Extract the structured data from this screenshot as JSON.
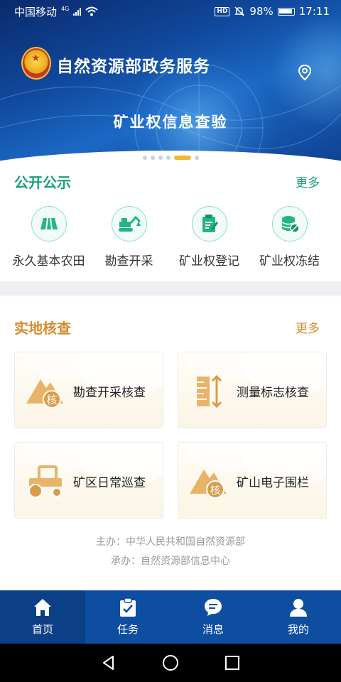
{
  "status_bar": {
    "carrier": "中国移动",
    "network": "4G",
    "battery": "98%",
    "time": "17:11",
    "hd": "HD"
  },
  "banner": {
    "title": "自然资源部政务服务",
    "subtitle": "矿业权信息查验",
    "carousel_total": 6,
    "carousel_active": 5
  },
  "public": {
    "title": "公开公示",
    "more": "更多",
    "items": [
      {
        "label": "永久基本农田",
        "icon": "farmland-icon"
      },
      {
        "label": "勘查开采",
        "icon": "excavator-icon"
      },
      {
        "label": "矿业权登记",
        "icon": "register-icon"
      },
      {
        "label": "矿业权冻结",
        "icon": "freeze-icon"
      }
    ]
  },
  "inspection": {
    "title": "实地核查",
    "more": "更多",
    "cards": [
      {
        "label": "勘查开采核查",
        "icon": "mountain-check-icon"
      },
      {
        "label": "测量标志核查",
        "icon": "measure-marker-icon"
      },
      {
        "label": "矿区日常巡查",
        "icon": "tractor-icon"
      },
      {
        "label": "矿山电子围栏",
        "icon": "mountain-check-icon"
      }
    ],
    "badge_char": "核"
  },
  "footer": {
    "host": "主办：中华人民共和国自然资源部",
    "organizer": "承办：自然资源部信息中心"
  },
  "tabs": [
    {
      "label": "首页",
      "icon": "home-icon",
      "active": true
    },
    {
      "label": "任务",
      "icon": "task-clipboard-icon",
      "active": false
    },
    {
      "label": "消息",
      "icon": "message-icon",
      "active": false
    },
    {
      "label": "我的",
      "icon": "user-icon",
      "active": false
    }
  ],
  "colors": {
    "primary_blue": "#0d4ea1",
    "green": "#1aa07b",
    "orange": "#d58a2e",
    "card_icon": "#e8b46a"
  }
}
